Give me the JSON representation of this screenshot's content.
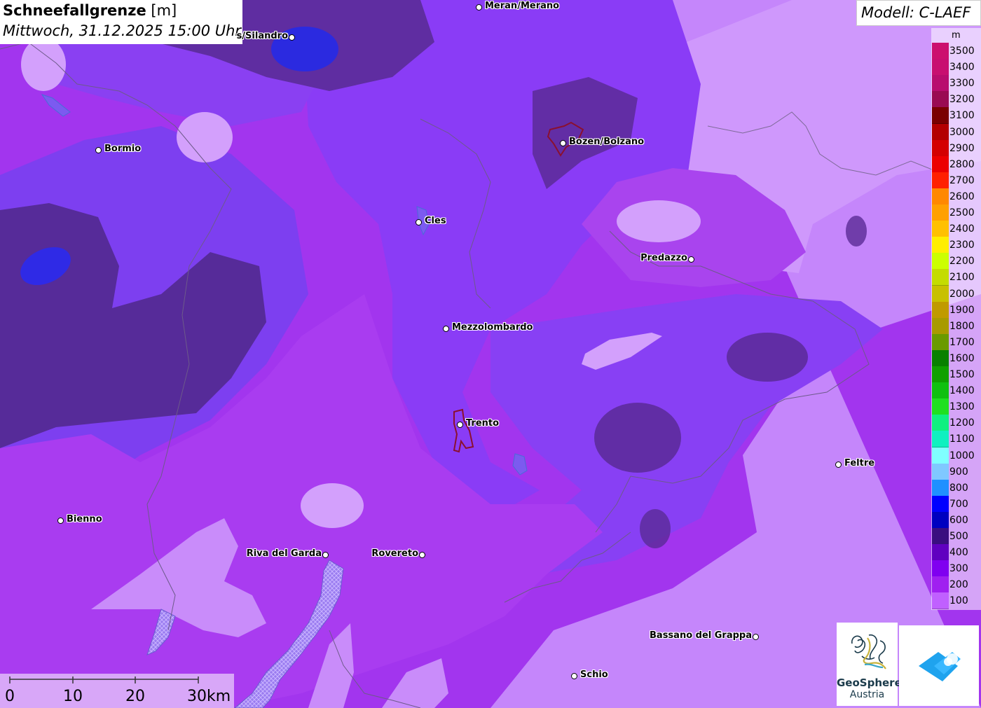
{
  "header": {
    "title": "Schneefallgrenze",
    "unit": "[m]",
    "datetime": "Mittwoch, 31.12.2025 15:00 Uhr"
  },
  "model": "Modell: C-LAEF",
  "legend": {
    "unit": "m",
    "entries": [
      {
        "label": "3500",
        "color": "#cc0f6e"
      },
      {
        "label": "3400",
        "color": "#c80e70"
      },
      {
        "label": "3300",
        "color": "#b80c6e"
      },
      {
        "label": "3200",
        "color": "#9a0a52"
      },
      {
        "label": "3100",
        "color": "#7a0000"
      },
      {
        "label": "3000",
        "color": "#b30000"
      },
      {
        "label": "2900",
        "color": "#d40000"
      },
      {
        "label": "2800",
        "color": "#ec0000"
      },
      {
        "label": "2700",
        "color": "#ff2000"
      },
      {
        "label": "2600",
        "color": "#ff8800"
      },
      {
        "label": "2500",
        "color": "#ffa000"
      },
      {
        "label": "2400",
        "color": "#ffc000"
      },
      {
        "label": "2300",
        "color": "#ffee00"
      },
      {
        "label": "2200",
        "color": "#ccff00"
      },
      {
        "label": "2100",
        "color": "#c4dc00"
      },
      {
        "label": "2000",
        "color": "#c8c000"
      },
      {
        "label": "1900",
        "color": "#c09a00"
      },
      {
        "label": "1800",
        "color": "#a89a00"
      },
      {
        "label": "1700",
        "color": "#6a9a00"
      },
      {
        "label": "1600",
        "color": "#088000"
      },
      {
        "label": "1500",
        "color": "#10a000"
      },
      {
        "label": "1400",
        "color": "#10c010"
      },
      {
        "label": "1300",
        "color": "#20e020"
      },
      {
        "label": "1200",
        "color": "#10f080"
      },
      {
        "label": "1100",
        "color": "#10f0c0"
      },
      {
        "label": "1000",
        "color": "#80ffff"
      },
      {
        "label": "900",
        "color": "#80c8ff"
      },
      {
        "label": "800",
        "color": "#2090ff"
      },
      {
        "label": "700",
        "color": "#0000ff"
      },
      {
        "label": "600",
        "color": "#0000c0"
      },
      {
        "label": "500",
        "color": "#3a0e80"
      },
      {
        "label": "400",
        "color": "#6000c0"
      },
      {
        "label": "300",
        "color": "#8000f0"
      },
      {
        "label": "200",
        "color": "#a020f0"
      },
      {
        "label": "100",
        "color": "#c060ff"
      }
    ]
  },
  "cities": [
    {
      "name": "Meran/Merano",
      "label_side": "right"
    },
    {
      "name": "s/Silandro",
      "label_side": "left"
    },
    {
      "name": "Bormio",
      "label_side": "right"
    },
    {
      "name": "Bozen/Bolzano",
      "label_side": "right"
    },
    {
      "name": "Cles",
      "label_side": "right"
    },
    {
      "name": "Predazzo",
      "label_side": "left"
    },
    {
      "name": "Mezzolombardo",
      "label_side": "right"
    },
    {
      "name": "Trento",
      "label_side": "right"
    },
    {
      "name": "Feltre",
      "label_side": "right"
    },
    {
      "name": "Bienno",
      "label_side": "right"
    },
    {
      "name": "Riva del Garda",
      "label_side": "left"
    },
    {
      "name": "Rovereto",
      "label_side": "left"
    },
    {
      "name": "Bassano del Grappa",
      "label_side": "left"
    },
    {
      "name": "Schio",
      "label_side": "right"
    }
  ],
  "scale": {
    "labels": [
      "0",
      "10",
      "20",
      "30km"
    ]
  },
  "logos": {
    "geosphere_name": "GeoSphere",
    "geosphere_sub": "Austria"
  },
  "colors": {
    "base_purple": "#9b3df0",
    "violet": "#8a35f5",
    "light_lilac": "#c67dfb",
    "dark_band": "#5a2a9c",
    "blue_core": "#2b2ae0",
    "magenta": "#b030f0"
  }
}
